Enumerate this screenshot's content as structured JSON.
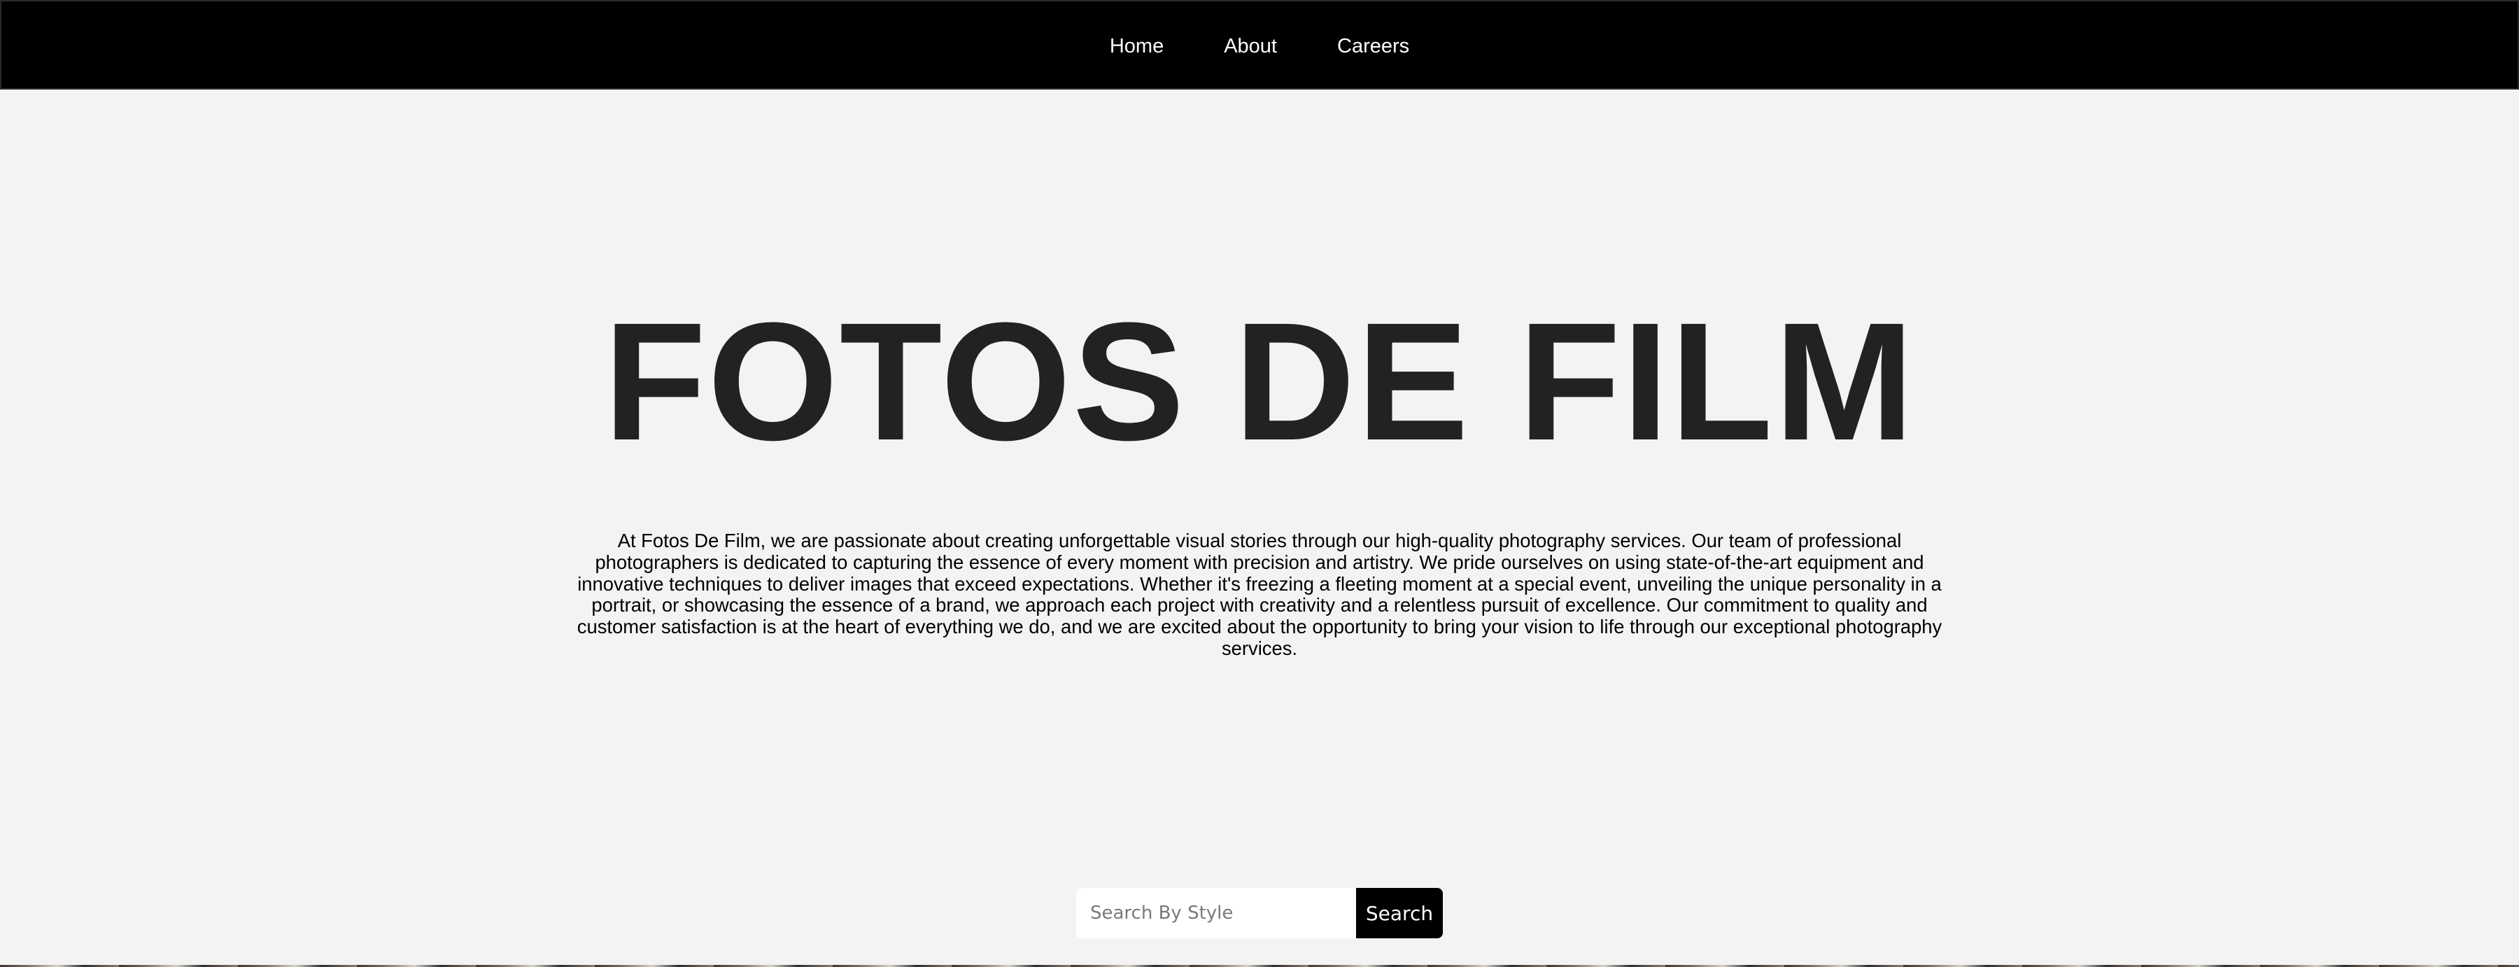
{
  "nav": {
    "items": [
      {
        "label": "Home"
      },
      {
        "label": "About"
      },
      {
        "label": "Careers"
      }
    ]
  },
  "hero": {
    "title": "FOTOS DE FILM",
    "description": "At Fotos De Film, we are passionate about creating unforgettable visual stories through our high-quality photography services. Our team of professional photographers is dedicated to capturing the essence of every moment with precision and artistry. We pride ourselves on using state-of-the-art equipment and innovative techniques to deliver images that exceed expectations. Whether it's freezing a fleeting moment at a special event, unveiling the unique personality in a portrait, or showcasing the essence of a brand, we approach each project with creativity and a relentless pursuit of excellence. Our commitment to quality and customer satisfaction is at the heart of everything we do, and we are excited about the opportunity to bring your vision to life through our exceptional photography services."
  },
  "search": {
    "placeholder": "Search By Style",
    "value": "",
    "button_label": "Search"
  },
  "colors": {
    "nav_background": "#000000",
    "page_background": "#f3f3f3",
    "title_text": "#222222",
    "body_text": "#000000",
    "button_background": "#000000",
    "button_text": "#ffffff"
  }
}
